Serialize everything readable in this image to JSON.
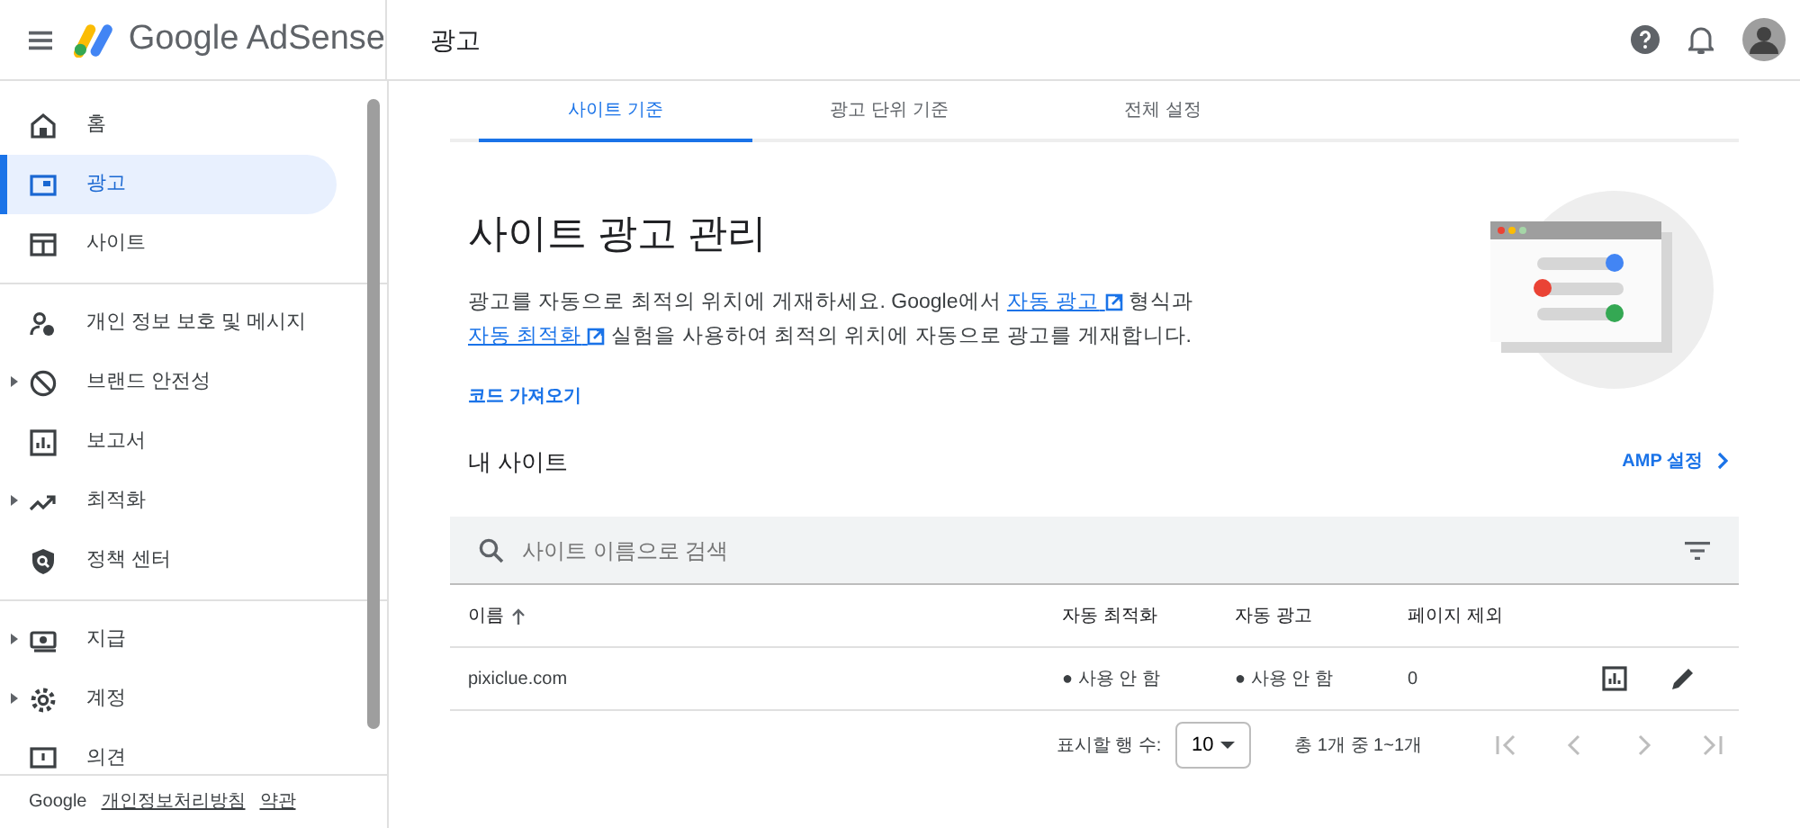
{
  "header": {
    "product": "Google AdSense",
    "page_title": "광고"
  },
  "sidebar": {
    "sections": [
      {
        "items": [
          {
            "label": "홈",
            "selected": false,
            "expandable": false
          },
          {
            "label": "광고",
            "selected": true,
            "expandable": false
          },
          {
            "label": "사이트",
            "selected": false,
            "expandable": false
          }
        ]
      },
      {
        "items": [
          {
            "label": "개인 정보 보호 및 메시지",
            "selected": false,
            "expandable": false
          },
          {
            "label": "브랜드 안전성",
            "selected": false,
            "expandable": true
          },
          {
            "label": "보고서",
            "selected": false,
            "expandable": false
          },
          {
            "label": "최적화",
            "selected": false,
            "expandable": true
          },
          {
            "label": "정책 센터",
            "selected": false,
            "expandable": false
          }
        ]
      },
      {
        "items": [
          {
            "label": "지급",
            "selected": false,
            "expandable": true
          },
          {
            "label": "계정",
            "selected": false,
            "expandable": true
          },
          {
            "label": "의견",
            "selected": false,
            "expandable": false
          }
        ]
      }
    ],
    "footer": [
      {
        "text": "Google",
        "kind": "brand"
      },
      {
        "text": "개인정보처리방침",
        "kind": "link"
      },
      {
        "text": "약관",
        "kind": "link"
      }
    ]
  },
  "tabs": [
    {
      "label": "사이트 기준",
      "selected": true
    },
    {
      "label": "광고 단위 기준",
      "selected": false
    },
    {
      "label": "전체 설정",
      "selected": false
    }
  ],
  "heading": "사이트 광고 관리",
  "description": [
    {
      "kind": "text",
      "text": "광고를 자동으로 최적의 위치에 게재하세요. Google에서 "
    },
    {
      "kind": "link",
      "text": "자동 광고"
    },
    {
      "kind": "text",
      "text": " 형식과 "
    },
    {
      "kind": "break"
    },
    {
      "kind": "link",
      "text": "자동 최적화"
    },
    {
      "kind": "text",
      "text": " 실험을 사용하여 최적의 위치에 자동으로 광고를 게재합니다."
    }
  ],
  "get_code": "코드 가져오기",
  "my_sites": {
    "title": "내 사이트",
    "amp_link": "AMP 설정",
    "search": {
      "placeholder": "사이트 이름으로 검색"
    },
    "table": {
      "columns": [
        {
          "label": "이름",
          "sorted": true
        },
        {
          "label": "자동 최적화",
          "sorted": false
        },
        {
          "label": "자동 광고",
          "sorted": false
        },
        {
          "label": "페이지 제외",
          "sorted": false
        }
      ],
      "rows": [
        [
          "pixiclue.com",
          "● 사용 안 함",
          "● 사용 안 함",
          "0"
        ]
      ]
    },
    "pagination": {
      "rows_label": "표시할 행 수:",
      "rows_value": "10",
      "range": "총 1개 중 1~1개"
    }
  }
}
